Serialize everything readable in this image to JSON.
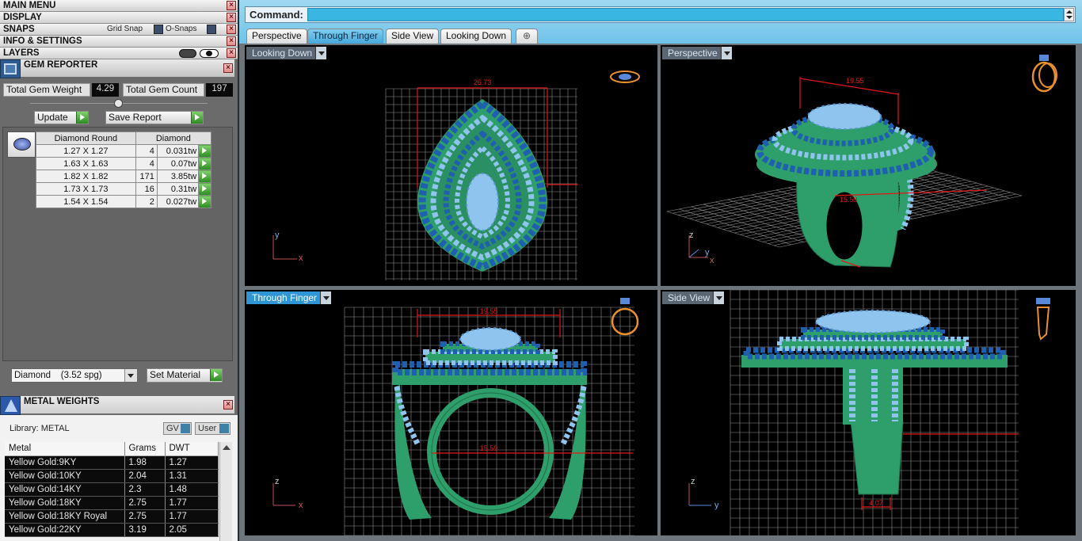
{
  "menu": {
    "main_menu": "MAIN MENU",
    "display": "DISPLAY",
    "snaps": "SNAPS",
    "grid_snap": "Grid Snap",
    "o_snaps": "O-Snaps",
    "info_settings": "INFO & SETTINGS",
    "layers": "LAYERS"
  },
  "gem_reporter": {
    "title": "GEM REPORTER",
    "total_weight_label": "Total Gem Weight",
    "total_weight": "4.29",
    "total_count_label": "Total Gem Count",
    "total_count": "197",
    "update_label": "Update",
    "save_report_label": "Save Report",
    "columns": [
      "Diamond Round",
      "Diamond"
    ],
    "rows": [
      {
        "size": "1.27 X 1.27",
        "count": "4",
        "weight": "0.031tw"
      },
      {
        "size": "1.63 X 1.63",
        "count": "4",
        "weight": "0.07tw"
      },
      {
        "size": "1.82 X 1.82",
        "count": "171",
        "weight": "3.85tw"
      },
      {
        "size": "1.73 X 1.73",
        "count": "16",
        "weight": "0.31tw"
      },
      {
        "size": "1.54 X 1.54",
        "count": "2",
        "weight": "0.027tw"
      }
    ],
    "material_select": "Diamond    (3.52 spg)",
    "set_material_label": "Set Material"
  },
  "metal_weights": {
    "title": "METAL WEIGHTS",
    "library_label": "Library: METAL",
    "gv_label": "GV",
    "user_label": "User",
    "columns": [
      "Metal",
      "Grams",
      "DWT"
    ],
    "rows": [
      {
        "metal": "Yellow Gold:9KY",
        "grams": "1.98",
        "dwt": "1.27"
      },
      {
        "metal": "Yellow Gold:10KY",
        "grams": "2.04",
        "dwt": "1.31"
      },
      {
        "metal": "Yellow Gold:14KY",
        "grams": "2.3",
        "dwt": "1.48"
      },
      {
        "metal": "Yellow Gold:18KY",
        "grams": "2.75",
        "dwt": "1.77"
      },
      {
        "metal": "Yellow Gold:18KY Royal",
        "grams": "2.75",
        "dwt": "1.77"
      },
      {
        "metal": "Yellow Gold:22KY",
        "grams": "3.19",
        "dwt": "2.05"
      }
    ]
  },
  "command": {
    "label": "Command:",
    "value": ""
  },
  "tabs": [
    "Perspective",
    "Through Finger",
    "Side View",
    "Looking Down"
  ],
  "active_tab": "Through Finger",
  "viewports": {
    "top_left": {
      "label": "Looking Down",
      "dimension": "26.73",
      "axis_v": "y",
      "axis_h": "x"
    },
    "top_right": {
      "label": "Perspective",
      "dimension": "19.55",
      "dimension_2": "15.59",
      "axis_v": "z",
      "axis_y": "y",
      "axis_h": "x"
    },
    "bottom_left": {
      "label": "Through Finger",
      "dimension": "19.55",
      "dimension_2": "15.59",
      "axis_v": "z",
      "axis_h": "x"
    },
    "bottom_right": {
      "label": "Side View",
      "dimension": "4.07",
      "axis_v": "z",
      "axis_h": "y"
    }
  },
  "colors": {
    "metal": "#2e9e6a",
    "gem_light": "#8ec4ee",
    "gem_dark": "#1f5fb0",
    "dimension": "#e01818",
    "grid": "#9a9a9a",
    "accent": "#2f95d4"
  }
}
